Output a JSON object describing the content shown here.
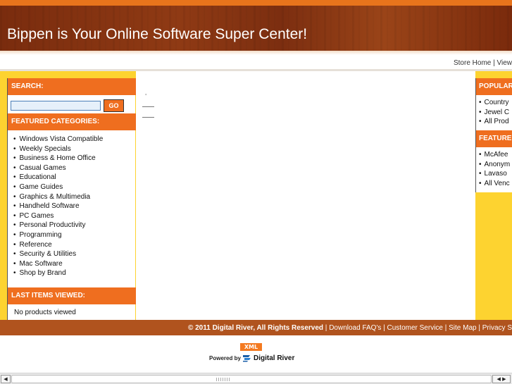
{
  "header": {
    "title": "Bippen is Your Online Software Super Center!"
  },
  "store_links": {
    "store_home": "Store Home",
    "separator": " | ",
    "view": "View"
  },
  "left": {
    "search_heading": "SEARCH:",
    "search_placeholder": "",
    "go_label": "GO",
    "featured_heading": "FEATURED CATEGORIES:",
    "categories": [
      "Windows Vista Compatible",
      "Weekly Specials",
      "Business & Home Office",
      "Casual Games",
      "Educational",
      "Game Guides",
      "Graphics & Multimedia",
      "Handheld Software",
      "PC Games",
      "Personal Productivity",
      "Programming",
      "Reference",
      "Security & Utilities",
      "Mac Software",
      "Shop by Brand"
    ],
    "last_heading": "LAST ITEMS VIEWED:",
    "last_text": "No products viewed"
  },
  "center": {
    "mark": "'"
  },
  "right": {
    "popular_heading": "POPULAR",
    "popular_items": [
      "Country",
      "Jewel C",
      "All Prod"
    ],
    "featured_heading": "FEATURE",
    "featured_items": [
      "McAfee",
      "Anonym",
      "Lavaso",
      "All Venc"
    ]
  },
  "footer": {
    "copyright": "© 2011 Digital River, All Rights Reserved",
    "sep": " | ",
    "links": [
      "Download FAQ's",
      "Customer Service",
      "Site Map",
      "Privacy S"
    ]
  },
  "badges": {
    "xml": "XML",
    "powered_by": "Powered by",
    "digital_river": "Digital River"
  },
  "scrollbar": {
    "left_arrow": "◀",
    "right_arrow": "◀ ▶"
  },
  "colors": {
    "orange": "#ef6e1f",
    "yellow": "#fdd330",
    "brown": "#b0531e"
  }
}
